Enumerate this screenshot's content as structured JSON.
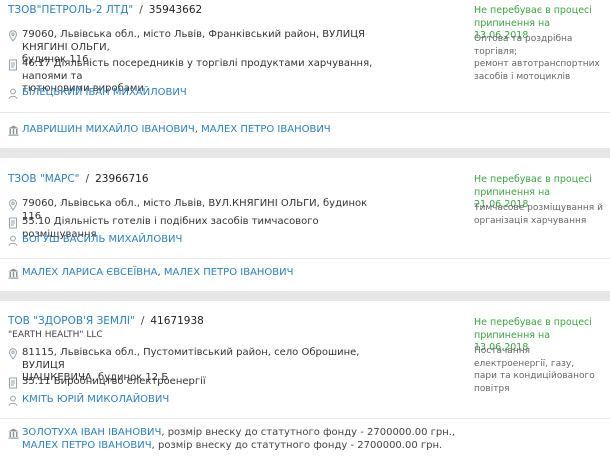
{
  "companies": [
    {
      "name": "ТЗОВ\"ПЕТРОЛЬ-2 ЛТД\"",
      "separator": "/",
      "code": "35943662",
      "english_name": "",
      "status_line1": "Не перебуває в процесі",
      "status_line2": "припинення на 13.06.2018",
      "activity_line1": "Оптова та роздрібна торгівля;",
      "activity_line2": "ремонт автотранспортних",
      "activity_line3": "засобів і мотоциклів",
      "address_line1": "79060, Львівська обл., місто Львів, Франківський район, ВУЛИЦЯ КНЯГИНІ ОЛЬГИ,",
      "address_line2": "будинок 116",
      "kved_line1": "46.17 Діяльність посередників у торгівлі продуктами харчування, напоями та",
      "kved_line2": "тютюновими виробами",
      "director": "БІЛЕЦЬКИЙ ІВАН МИХАЙЛОВИЧ",
      "founders": [
        "ЛАВРИШИН МИХАЙЛО ІВАНОВИЧ",
        "МАЛЕХ ПЕТРО ІВАНОВИЧ"
      ],
      "founders_sep": ", "
    },
    {
      "name": "ТЗОВ \"МАРС\"",
      "separator": "/",
      "code": "23966716",
      "status_line1": "Не перебуває в процесі",
      "status_line2": "припинення на 21.06.2018",
      "activity_line1": "Тимчасове розміщування й",
      "activity_line2": "організація харчування",
      "address_line1": "79060, Львівська обл., місто Львів, ВУЛ.КНЯГИНІ ОЛЬГИ, будинок 116",
      "kved_line1": "55.10 Діяльність готелів і подібних засобів тимчасового розміщування",
      "director": "БОГУШ ВАСИЛЬ МИХАЙЛОВИЧ",
      "founders": [
        "МАЛЕХ ЛАРИСА ЄВСЕЇВНА",
        "МАЛЕХ ПЕТРО ІВАНОВИЧ"
      ],
      "founders_sep": ", "
    },
    {
      "name": "ТОВ \"ЗДОРОВ'Я ЗЕМЛІ\"",
      "separator": "/",
      "code": "41671938",
      "english_name": "\"EARTH HEALTH\" LLC",
      "status_line1": "Не перебуває в процесі",
      "status_line2": "припинення на 13.06.2018",
      "activity_line1": "Постачання електроенергії, газу,",
      "activity_line2": "пари та кондиційованого",
      "activity_line3": "повітря",
      "address_line1": "81115, Львівська обл., Пустомитівський район, село Оброшине, ВУЛИЦЯ",
      "address_line2": "ШАШКЕВИЧА, будинок 12 Б",
      "kved_line1": "35.11 Виробництво електроенергії",
      "director": "КМІТЬ ЮРІЙ МИКОЛАЙОВИЧ",
      "founders": [
        "ЗОЛОТУХА ІВАН ІВАНОВИЧ",
        "МАЛЕХ ПЕТРО ІВАНОВИЧ"
      ],
      "founder_share": ", розмір внеску до статутного фонду - 2700000.00 грн.,",
      "founder_share2": ", розмір внеску до статутного фонду - 2700000.00 грн."
    }
  ],
  "colors": {
    "link": "#2a7fc1",
    "status_green": "#3aa641",
    "gap_gray": "#e6e6e6"
  },
  "icons": {
    "address": "map-pin-icon",
    "kved": "document-icon",
    "director": "person-icon",
    "founders": "bank-icon"
  }
}
